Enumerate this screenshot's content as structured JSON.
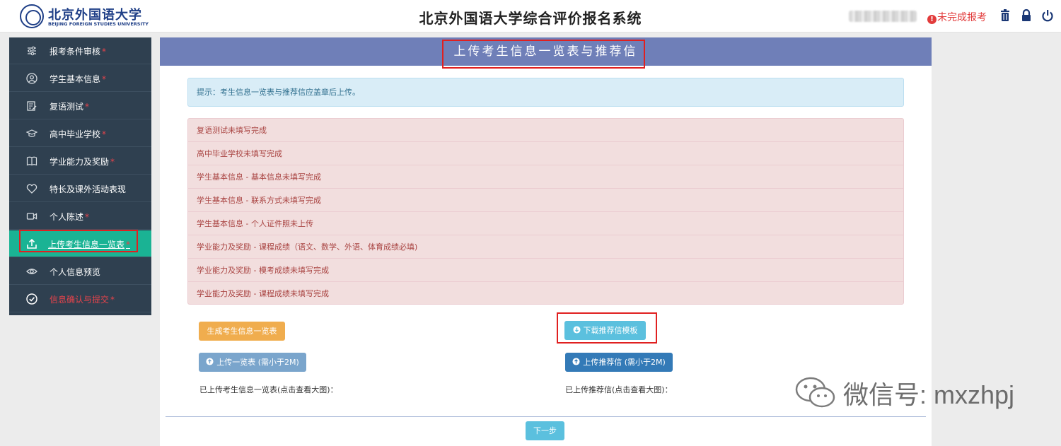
{
  "header": {
    "logo_cn": "北京外国语大学",
    "logo_en": "BEIJING FOREIGN STUDIES UNIVERSITY",
    "title": "北京外国语大学综合评价报名系统",
    "status_text": "未完成报考",
    "status_icon": "!",
    "icons": [
      "trash-icon",
      "lock-icon",
      "power-icon"
    ]
  },
  "sidebar": {
    "items": [
      {
        "label": "报考条件审核",
        "required": "*",
        "icon": "sliders-icon"
      },
      {
        "label": "学生基本信息",
        "required": "*",
        "icon": "user-circle-icon"
      },
      {
        "label": "复语测试",
        "required": "*",
        "icon": "edit-document-icon"
      },
      {
        "label": "高中毕业学校",
        "required": "*",
        "icon": "graduation-cap-icon"
      },
      {
        "label": "学业能力及奖励",
        "required": "*",
        "icon": "book-icon"
      },
      {
        "label": "特长及课外活动表现",
        "required": "",
        "icon": "heart-icon"
      },
      {
        "label": "个人陈述",
        "required": "*",
        "icon": "video-camera-icon"
      },
      {
        "label": "上传考生信息一览表",
        "required": "*",
        "icon": "upload-icon"
      },
      {
        "label": "个人信息预览",
        "required": "",
        "icon": "eye-icon"
      },
      {
        "label": "信息确认与提交",
        "required": "*",
        "icon": "check-circle-icon"
      }
    ],
    "active_index": 7
  },
  "main": {
    "banner_title": "上传考生信息一览表与推荐信",
    "tip": "提示：考生信息一览表与推荐信应盖章后上传。",
    "errors": [
      "复语测试未填写完成",
      "高中毕业学校未填写完成",
      "学生基本信息 - 基本信息未填写完成",
      "学生基本信息 - 联系方式未填写完成",
      "学生基本信息 - 个人证件照未上传",
      "学业能力及奖励 - 课程成绩（语文、数学、外语、体育成绩必填)",
      "学业能力及奖励 - 模考成绩未填写完成",
      "学业能力及奖励 - 课程成绩未填写完成"
    ],
    "buttons": {
      "generate": "生成考生信息一览表",
      "download_template": "下载推荐信模板",
      "upload_list": "上传一览表 (需小于2M)",
      "upload_letter": "上传推荐信 (需小于2M)",
      "next": "下一步"
    },
    "uploaded_list_label": "已上传考生信息一览表(点击查看大图)：",
    "uploaded_letter_label": "已上传推荐信(点击查看大图)："
  },
  "watermark": {
    "text": "微信号: mxzhpj"
  },
  "colors": {
    "sidebar_bg": "#2f4050",
    "sidebar_active": "#1ab394",
    "banner_bg": "#6f7fb8",
    "status_red": "#e23b3b",
    "highlight_box": "#e02020"
  }
}
